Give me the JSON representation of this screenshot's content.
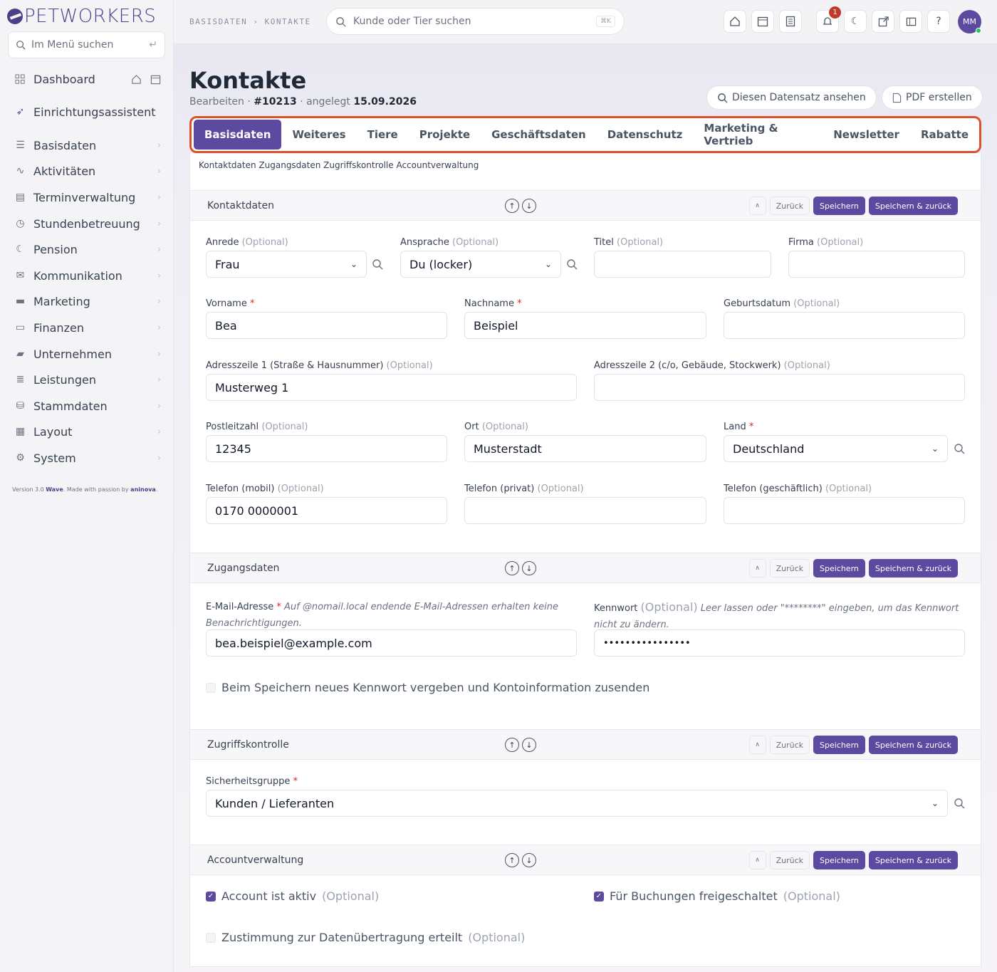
{
  "app": {
    "brand": "PETWORKERS"
  },
  "sidebar": {
    "search_placeholder": "Im Menü suchen",
    "items": [
      {
        "label": "Dashboard",
        "icon": "grid-icon"
      },
      {
        "label": "Einrichtungsassistent",
        "icon": "rocket-icon"
      },
      {
        "label": "Basisdaten",
        "icon": "user-list-icon"
      },
      {
        "label": "Aktivitäten",
        "icon": "pulse-icon"
      },
      {
        "label": "Terminverwaltung",
        "icon": "calendar-icon"
      },
      {
        "label": "Stundenbetreuung",
        "icon": "clock-icon"
      },
      {
        "label": "Pension",
        "icon": "moon-icon"
      },
      {
        "label": "Kommunikation",
        "icon": "mail-icon"
      },
      {
        "label": "Marketing",
        "icon": "chat-icon"
      },
      {
        "label": "Finanzen",
        "icon": "card-icon"
      },
      {
        "label": "Unternehmen",
        "icon": "briefcase-icon"
      },
      {
        "label": "Leistungen",
        "icon": "list-icon"
      },
      {
        "label": "Stammdaten",
        "icon": "database-icon"
      },
      {
        "label": "Layout",
        "icon": "layout-icon"
      },
      {
        "label": "System",
        "icon": "gear-icon"
      }
    ],
    "version_prefix": "Version 3.0",
    "version_name": "Wave",
    "version_middle": ". Made with passion by",
    "version_company": "aninova"
  },
  "topbar": {
    "breadcrumb": "BASISDATEN › KONTAKTE",
    "search_placeholder": "Kunde oder Tier suchen",
    "search_shortcut": "⌘K",
    "notification_count": "1",
    "help": "?",
    "avatar_initials": "MM"
  },
  "page": {
    "title": "Kontakte",
    "sub_edit": "Bearbeiten",
    "sub_id": "#10213",
    "sub_created_label": "angelegt",
    "sub_created_date": "15.09.2026",
    "view_record": "Diesen Datensatz ansehen",
    "create_pdf": "PDF erstellen"
  },
  "tabs": [
    "Basisdaten",
    "Weiteres",
    "Tiere",
    "Projekte",
    "Geschäftsdaten",
    "Datenschutz",
    "Marketing & Vertrieb",
    "Newsletter",
    "Rabatte"
  ],
  "subnav": "Kontaktdaten Zugangsdaten Zugriffskontrolle Accountverwaltung",
  "section_buttons": {
    "back": "Zurück",
    "save": "Speichern",
    "save_back": "Speichern & zurück"
  },
  "sections": {
    "kontakt": "Kontaktdaten",
    "zugang": "Zugangsdaten",
    "zugriff": "Zugriffskontrolle",
    "account": "Accountverwaltung"
  },
  "optional": "(Optional)",
  "required": "*",
  "fields": {
    "anrede": {
      "label": "Anrede",
      "value": "Frau"
    },
    "ansprache": {
      "label": "Ansprache",
      "value": "Du (locker)"
    },
    "titel": {
      "label": "Titel",
      "value": ""
    },
    "firma": {
      "label": "Firma",
      "value": ""
    },
    "vorname": {
      "label": "Vorname",
      "value": "Bea"
    },
    "nachname": {
      "label": "Nachname",
      "value": "Beispiel"
    },
    "geburtsdatum": {
      "label": "Geburtsdatum",
      "value": ""
    },
    "adresse1": {
      "label": "Adresszeile 1 (Straße & Hausnummer)",
      "value": "Musterweg 1"
    },
    "adresse2": {
      "label": "Adresszeile 2 (c/o, Gebäude, Stockwerk)",
      "value": ""
    },
    "plz": {
      "label": "Postleitzahl",
      "value": "12345"
    },
    "ort": {
      "label": "Ort",
      "value": "Musterstadt"
    },
    "land": {
      "label": "Land",
      "value": "Deutschland"
    },
    "tel_mobil": {
      "label": "Telefon (mobil)",
      "value": "0170 0000001"
    },
    "tel_privat": {
      "label": "Telefon (privat)",
      "value": ""
    },
    "tel_geschaeft": {
      "label": "Telefon (geschäftlich)",
      "value": ""
    },
    "email": {
      "label": "E-Mail-Adresse",
      "hint": "Auf @nomail.local endende E-Mail-Adressen erhalten keine Benachrichtigungen.",
      "value": "bea.beispiel@example.com"
    },
    "kennwort": {
      "label": "Kennwort",
      "hint": "Leer lassen oder \"********\" eingeben, um das Kennwort nicht zu ändern.",
      "value": "••••••••••••••••"
    },
    "sicherheitsgruppe": {
      "label": "Sicherheitsgruppe",
      "value": "Kunden / Lieferanten"
    }
  },
  "checkboxes": {
    "neues_kennwort": {
      "label": "Beim Speichern neues Kennwort vergeben und Kontoinformation zusenden",
      "checked": false
    },
    "account_aktiv": {
      "label": "Account ist aktiv",
      "checked": true
    },
    "buchungen": {
      "label": "Für Buchungen freigeschaltet",
      "checked": true
    },
    "zustimmung": {
      "label": "Zustimmung zur Datenübertragung erteilt",
      "checked": false
    }
  },
  "colors": {
    "accent": "#5b4aa0",
    "highlight": "#d9522b",
    "required": "#dc2626"
  }
}
